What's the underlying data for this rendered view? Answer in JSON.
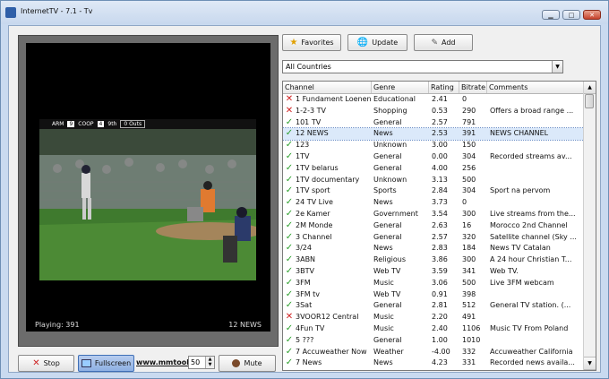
{
  "window": {
    "title": "InternetTV - 7.1 - Tv"
  },
  "player": {
    "playing_text": "Playing: 391",
    "channel_text": "12 NEWS"
  },
  "scorebug": {
    "team1": "ARM",
    "score1": "9",
    "team2": "COOP",
    "score2": "4",
    "inning": "9th",
    "outs": "0 Outs"
  },
  "controls": {
    "stop_label": "Stop",
    "fullscreen_label": "Fullscreen",
    "link_text": "www.mmtool",
    "volume_value": "50",
    "mute_label": "Mute"
  },
  "toolbar": {
    "favorites_label": "Favorites",
    "update_label": "Update",
    "add_label": "Add"
  },
  "filter": {
    "selected": "All Countries"
  },
  "columns": [
    "Channel",
    "Genre",
    "Rating",
    "Bitrate",
    "Comments"
  ],
  "channels": [
    {
      "status": "bad",
      "name": "1 Fundament Loenen",
      "genre": "Educational",
      "rating": "2.41",
      "bitrate": "0",
      "comment": ""
    },
    {
      "status": "bad",
      "name": "1-2-3 TV",
      "genre": "Shopping",
      "rating": "0.53",
      "bitrate": "290",
      "comment": "Offers a broad range ..."
    },
    {
      "status": "ok",
      "name": "101 TV",
      "genre": "General",
      "rating": "2.57",
      "bitrate": "791",
      "comment": ""
    },
    {
      "status": "ok",
      "name": "12 NEWS",
      "genre": "News",
      "rating": "2.53",
      "bitrate": "391",
      "comment": "NEWS CHANNEL",
      "selected": true
    },
    {
      "status": "ok",
      "name": "123",
      "genre": "Unknown",
      "rating": "3.00",
      "bitrate": "150",
      "comment": ""
    },
    {
      "status": "ok",
      "name": "1TV",
      "genre": "General",
      "rating": "0.00",
      "bitrate": "304",
      "comment": "Recorded streams av..."
    },
    {
      "status": "ok",
      "name": "1TV belarus",
      "genre": "General",
      "rating": "4.00",
      "bitrate": "256",
      "comment": ""
    },
    {
      "status": "ok",
      "name": "1TV documentary",
      "genre": "Unknown",
      "rating": "3.13",
      "bitrate": "500",
      "comment": ""
    },
    {
      "status": "ok",
      "name": "1TV sport",
      "genre": "Sports",
      "rating": "2.84",
      "bitrate": "304",
      "comment": "Sport na pervom"
    },
    {
      "status": "ok",
      "name": "24 TV Live",
      "genre": "News",
      "rating": "3.73",
      "bitrate": "0",
      "comment": ""
    },
    {
      "status": "ok",
      "name": "2e Kamer",
      "genre": "Government",
      "rating": "3.54",
      "bitrate": "300",
      "comment": "Live streams from the..."
    },
    {
      "status": "ok",
      "name": "2M Monde",
      "genre": "General",
      "rating": "2.63",
      "bitrate": "16",
      "comment": "Morocco 2nd Channel"
    },
    {
      "status": "ok",
      "name": "3 Channel",
      "genre": "General",
      "rating": "2.57",
      "bitrate": "320",
      "comment": "Satellite channel (Sky ..."
    },
    {
      "status": "ok",
      "name": "3/24",
      "genre": "News",
      "rating": "2.83",
      "bitrate": "184",
      "comment": "News TV Catalan"
    },
    {
      "status": "ok",
      "name": "3ABN",
      "genre": "Religious",
      "rating": "3.86",
      "bitrate": "300",
      "comment": "A 24 hour Christian T..."
    },
    {
      "status": "ok",
      "name": "3BTV",
      "genre": "Web TV",
      "rating": "3.59",
      "bitrate": "341",
      "comment": "Web TV."
    },
    {
      "status": "ok",
      "name": "3FM",
      "genre": "Music",
      "rating": "3.06",
      "bitrate": "500",
      "comment": "Live 3FM webcam"
    },
    {
      "status": "ok",
      "name": "3FM tv",
      "genre": "Web TV",
      "rating": "0.91",
      "bitrate": "398",
      "comment": ""
    },
    {
      "status": "ok",
      "name": "3Sat",
      "genre": "General",
      "rating": "2.81",
      "bitrate": "512",
      "comment": "General TV station. (..."
    },
    {
      "status": "bad",
      "name": "3VOOR12 Central",
      "genre": "Music",
      "rating": "2.20",
      "bitrate": "491",
      "comment": ""
    },
    {
      "status": "ok",
      "name": "4Fun TV",
      "genre": "Music",
      "rating": "2.40",
      "bitrate": "1106",
      "comment": "Music TV From Poland"
    },
    {
      "status": "ok",
      "name": "5 ???",
      "genre": "General",
      "rating": "1.00",
      "bitrate": "1010",
      "comment": ""
    },
    {
      "status": "ok",
      "name": "7 Accuweather Now",
      "genre": "Weather",
      "rating": "-4.00",
      "bitrate": "332",
      "comment": "Accuweather California"
    },
    {
      "status": "ok",
      "name": "7 News",
      "genre": "News",
      "rating": "4.23",
      "bitrate": "331",
      "comment": "Recorded news availa..."
    }
  ]
}
